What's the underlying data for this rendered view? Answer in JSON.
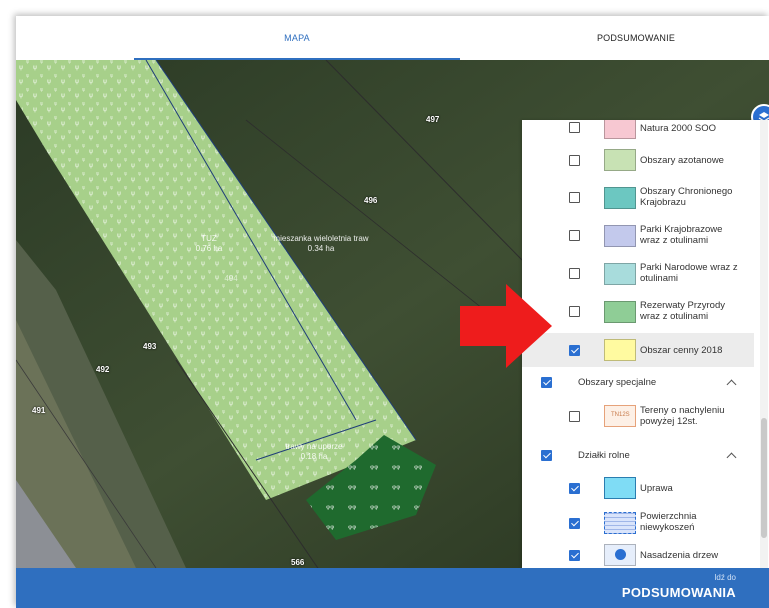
{
  "tabs": [
    {
      "label": "MAPA",
      "active": true
    },
    {
      "label": "PODSUMOWANIE",
      "active": false
    }
  ],
  "map": {
    "parcel_numbers": [
      "497",
      "496",
      "493",
      "492",
      "491",
      "566"
    ],
    "crops": [
      {
        "name": "TUZ",
        "area": "0.76 ha"
      },
      {
        "name": "mieszanka wieloletnia traw",
        "area": "0.34 ha"
      },
      {
        "name": "trawy na uporze",
        "area": "0.18 ha"
      }
    ],
    "inner_number": "404"
  },
  "legend": {
    "layers": [
      {
        "label": "Natura 2000 SOO",
        "checked": false,
        "color": "#f7c8d2"
      },
      {
        "label": "Obszary azotanowe",
        "checked": false,
        "color": "#c8e2b4"
      },
      {
        "label": "Obszary Chronionego Krajobrazu",
        "checked": false,
        "color": "#6cc7c1"
      },
      {
        "label": "Parki Krajobrazowe wraz z otulinami",
        "checked": false,
        "color": "#c3c9ec"
      },
      {
        "label": "Parki Narodowe wraz z otulinami",
        "checked": false,
        "color": "#a8dcdc"
      },
      {
        "label": "Rezerwaty Przyrody wraz z otulinami",
        "checked": false,
        "color": "#8fcd96"
      },
      {
        "label": "Obszar cenny 2018",
        "checked": true,
        "color": "#fffaa0"
      }
    ],
    "groups": [
      {
        "label": "Obszary specjalne",
        "checked": true,
        "items": [
          {
            "label": "Tereny o nachyleniu powyżej 12st.",
            "checked": false,
            "swatch_text": "TN12S"
          }
        ]
      },
      {
        "label": "Działki rolne",
        "checked": true,
        "items": [
          {
            "label": "Uprawa",
            "checked": true,
            "color": "#7fdcf5"
          },
          {
            "label": "Powierzchnia niewykoszeń",
            "checked": true,
            "color": "#d9e4fb"
          },
          {
            "label": "Nasadzenia drzew",
            "checked": true,
            "color": "#2a6fd1"
          }
        ]
      }
    ]
  },
  "footer": {
    "small": "Idź do",
    "big": "PODSUMOWANIA"
  },
  "colors": {
    "accent": "#2f6fbf",
    "arrow": "#ee1c1c"
  }
}
